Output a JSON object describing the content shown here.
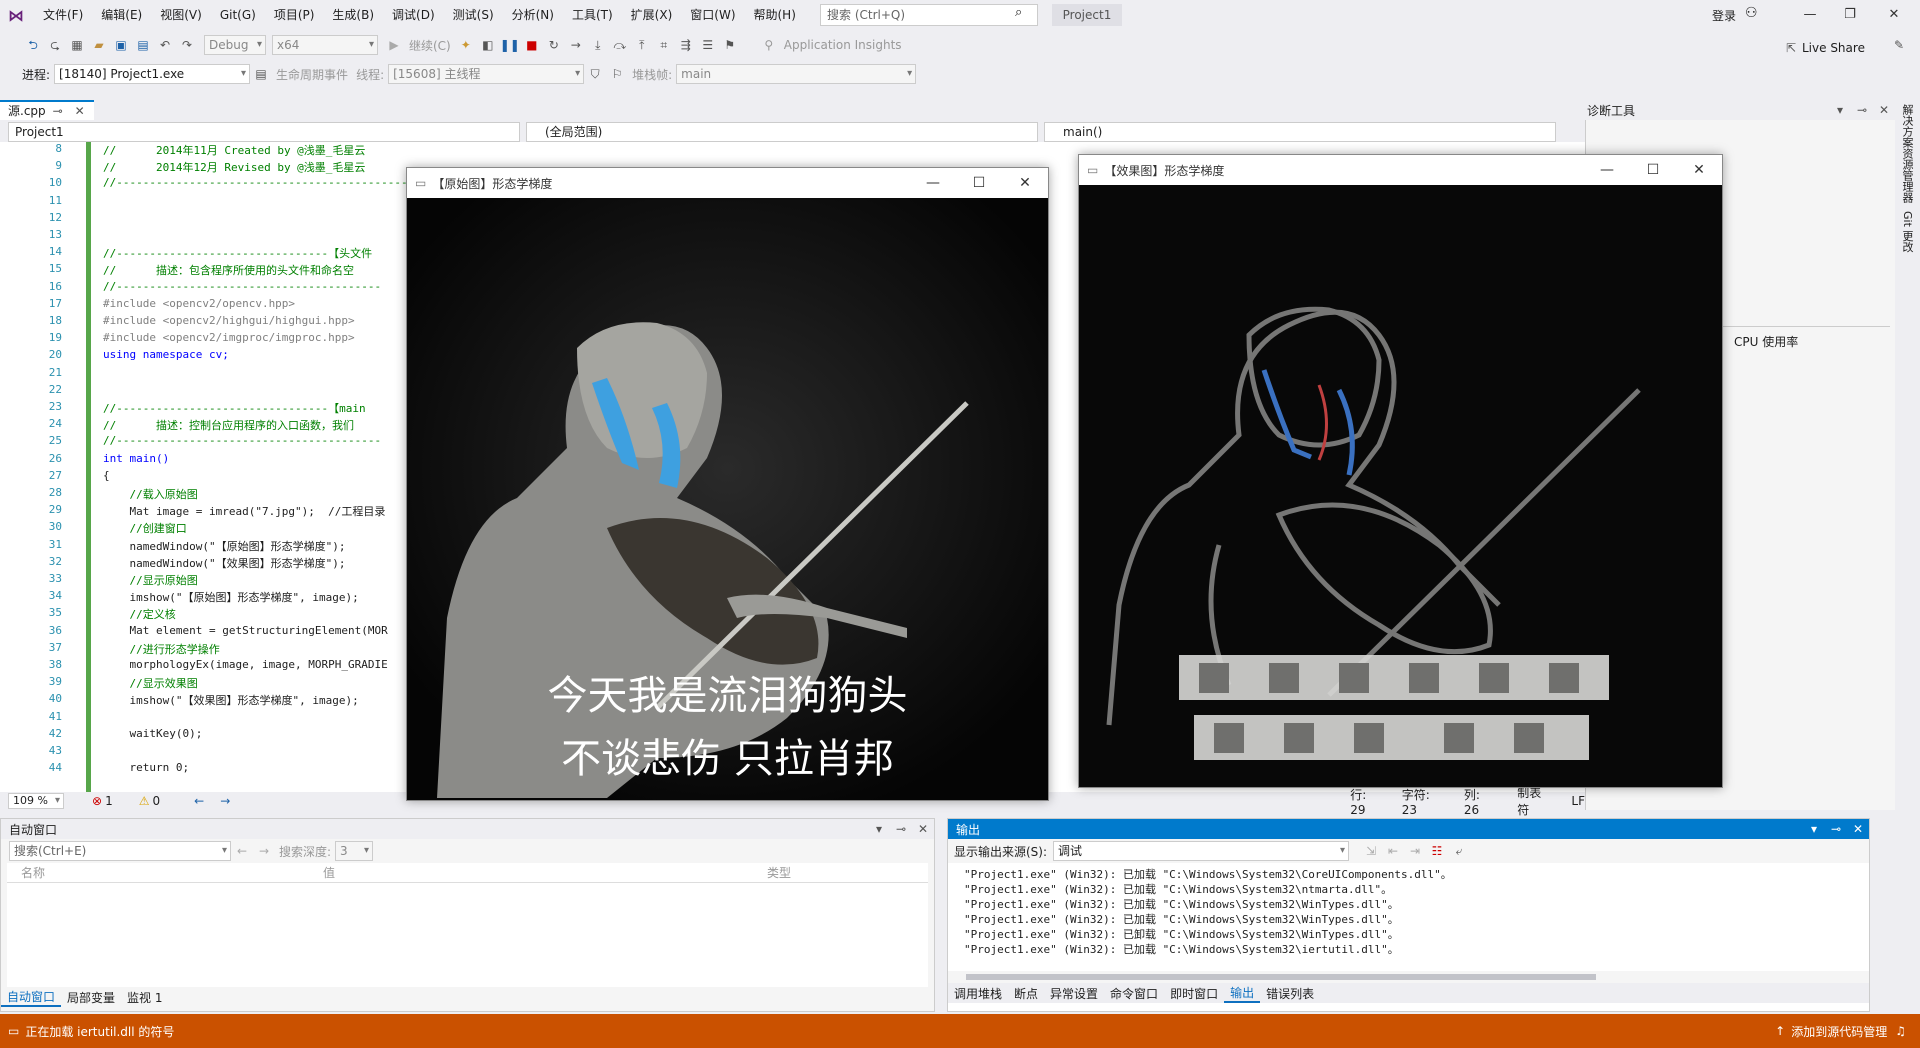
{
  "menu": {
    "items": [
      "文件(F)",
      "编辑(E)",
      "视图(V)",
      "Git(G)",
      "项目(P)",
      "生成(B)",
      "调试(D)",
      "测试(S)",
      "分析(N)",
      "工具(T)",
      "扩展(X)",
      "窗口(W)",
      "帮助(H)"
    ],
    "search_placeholder": "搜索 (Ctrl+Q)",
    "project": "Project1",
    "login": "登录"
  },
  "toolbar": {
    "config": "Debug",
    "platform": "x64",
    "continue": "继续(C)",
    "insights": "Application Insights",
    "liveshare": "Live Share"
  },
  "toolbar2": {
    "process_label": "进程:",
    "process": "[18140] Project1.exe",
    "lifecycle": "生命周期事件",
    "thread_label": "线程:",
    "thread": "[15608] 主线程",
    "stack_label": "堆栈帧:",
    "stack": "main"
  },
  "editor": {
    "tab": "源.cpp",
    "scope_project": "Project1",
    "scope_global": "(全局范围)",
    "scope_func": "main()",
    "zoom": "109 %",
    "errors": "1",
    "warnings": "0",
    "status": {
      "line": "行: 29",
      "char": "字符: 23",
      "col": "列: 26",
      "tabs": "制表符",
      "eol": "LF"
    },
    "lines": [
      {
        "n": "8",
        "t": "//      2014年11月 Created by @浅墨_毛星云",
        "c": "cm"
      },
      {
        "n": "9",
        "t": "//      2014年12月 Revised by @浅墨_毛星云",
        "c": "cm"
      },
      {
        "n": "10",
        "t": "//----------------------------------------------------------------",
        "c": "cm"
      },
      {
        "n": "11",
        "t": "",
        "c": ""
      },
      {
        "n": "12",
        "t": "",
        "c": ""
      },
      {
        "n": "13",
        "t": "",
        "c": ""
      },
      {
        "n": "14",
        "t": "//--------------------------------【头文件",
        "c": "cm"
      },
      {
        "n": "15",
        "t": "//      描述：包含程序所使用的头文件和命名空",
        "c": "cm"
      },
      {
        "n": "16",
        "t": "//----------------------------------------",
        "c": "cm"
      },
      {
        "n": "17",
        "t": "#include <opencv2/opencv.hpp>",
        "c": "pp"
      },
      {
        "n": "18",
        "t": "#include <opencv2/highgui/highgui.hpp>",
        "c": "pp"
      },
      {
        "n": "19",
        "t": "#include <opencv2/imgproc/imgproc.hpp>",
        "c": "pp"
      },
      {
        "n": "20",
        "t": "using namespace cv;",
        "c": "kw"
      },
      {
        "n": "21",
        "t": "",
        "c": ""
      },
      {
        "n": "22",
        "t": "",
        "c": ""
      },
      {
        "n": "23",
        "t": "//--------------------------------【main",
        "c": "cm"
      },
      {
        "n": "24",
        "t": "//      描述：控制台应用程序的入口函数，我们",
        "c": "cm"
      },
      {
        "n": "25",
        "t": "//----------------------------------------",
        "c": "cm"
      },
      {
        "n": "26",
        "t": "int main()",
        "c": "kw"
      },
      {
        "n": "27",
        "t": "{",
        "c": ""
      },
      {
        "n": "28",
        "t": "    //载入原始图",
        "c": "cm"
      },
      {
        "n": "29",
        "t": "    Mat image = imread(\"7.jpg\");  //工程目录",
        "c": ""
      },
      {
        "n": "30",
        "t": "    //创建窗口",
        "c": "cm"
      },
      {
        "n": "31",
        "t": "    namedWindow(\"【原始图】形态学梯度\");",
        "c": ""
      },
      {
        "n": "32",
        "t": "    namedWindow(\"【效果图】形态学梯度\");",
        "c": ""
      },
      {
        "n": "33",
        "t": "    //显示原始图",
        "c": "cm"
      },
      {
        "n": "34",
        "t": "    imshow(\"【原始图】形态学梯度\", image);",
        "c": ""
      },
      {
        "n": "35",
        "t": "    //定义核",
        "c": "cm"
      },
      {
        "n": "36",
        "t": "    Mat element = getStructuringElement(MOR",
        "c": ""
      },
      {
        "n": "37",
        "t": "    //进行形态学操作",
        "c": "cm"
      },
      {
        "n": "38",
        "t": "    morphologyEx(image, image, MORPH_GRADIE",
        "c": ""
      },
      {
        "n": "39",
        "t": "    //显示效果图",
        "c": "cm"
      },
      {
        "n": "40",
        "t": "    imshow(\"【效果图】形态学梯度\", image);",
        "c": ""
      },
      {
        "n": "41",
        "t": "",
        "c": ""
      },
      {
        "n": "42",
        "t": "    waitKey(0);",
        "c": ""
      },
      {
        "n": "43",
        "t": "",
        "c": ""
      },
      {
        "n": "44",
        "t": "    return 0;",
        "c": ""
      }
    ]
  },
  "diag": {
    "title": "诊断工具",
    "cpu": "CPU 使用率",
    "side1": "解决方案资源管理器",
    "side2": "Git 更改"
  },
  "win1": {
    "title": "【原始图】形态学梯度",
    "caption1": "今天我是流泪狗狗头",
    "caption2": "不谈悲伤 只拉肖邦"
  },
  "win2": {
    "title": "【效果图】形态学梯度"
  },
  "auto": {
    "title": "自动窗口",
    "search": "搜索(Ctrl+E)",
    "depth_label": "搜索深度:",
    "depth": "3",
    "col_name": "名称",
    "col_value": "值",
    "col_type": "类型",
    "tabs": [
      "自动窗口",
      "局部变量",
      "监视 1"
    ]
  },
  "output": {
    "title": "输出",
    "source_label": "显示输出来源(S):",
    "source": "调试",
    "lines": [
      "\"Project1.exe\" (Win32): 已加载 \"C:\\Windows\\System32\\CoreUIComponents.dll\"。",
      "\"Project1.exe\" (Win32): 已加载 \"C:\\Windows\\System32\\ntmarta.dll\"。",
      "\"Project1.exe\" (Win32): 已加载 \"C:\\Windows\\System32\\WinTypes.dll\"。",
      "\"Project1.exe\" (Win32): 已加载 \"C:\\Windows\\System32\\WinTypes.dll\"。",
      "\"Project1.exe\" (Win32): 已卸载 \"C:\\Windows\\System32\\WinTypes.dll\"。",
      "\"Project1.exe\" (Win32): 已加载 \"C:\\Windows\\System32\\iertutil.dll\"。"
    ],
    "tabs": [
      "调用堆栈",
      "断点",
      "异常设置",
      "命令窗口",
      "即时窗口",
      "输出",
      "错误列表"
    ]
  },
  "status": {
    "text": "正在加载 iertutil.dll 的符号",
    "source_control": "添加到源代码管理"
  }
}
